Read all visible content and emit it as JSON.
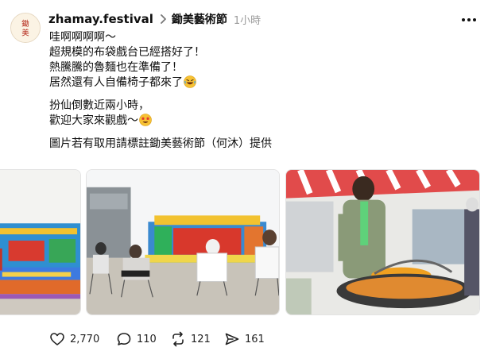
{
  "post": {
    "username": "zhamay.festival",
    "community": "鋤美藝術節",
    "time": "1小時",
    "avatar_text": [
      "鋤",
      "美"
    ],
    "lines": [
      "哇啊啊啊啊～",
      "超規模的布袋戲台已經搭好了！",
      "熱騰騰的魯麵也在準備了！",
      "居然還有人自備椅子都來了"
    ],
    "lines2": [
      "扮仙倒數近兩小時，",
      "歡迎大家來觀戲～"
    ],
    "credit": "圖片若有取用請標註鋤美藝術節（何沐）提供"
  },
  "actions": {
    "likes": "2,770",
    "comments": "110",
    "reposts": "121",
    "shares": "161"
  },
  "icons": {
    "emoji1": "rolling-laughing-emoji",
    "emoji2": "star-struck-emoji"
  }
}
